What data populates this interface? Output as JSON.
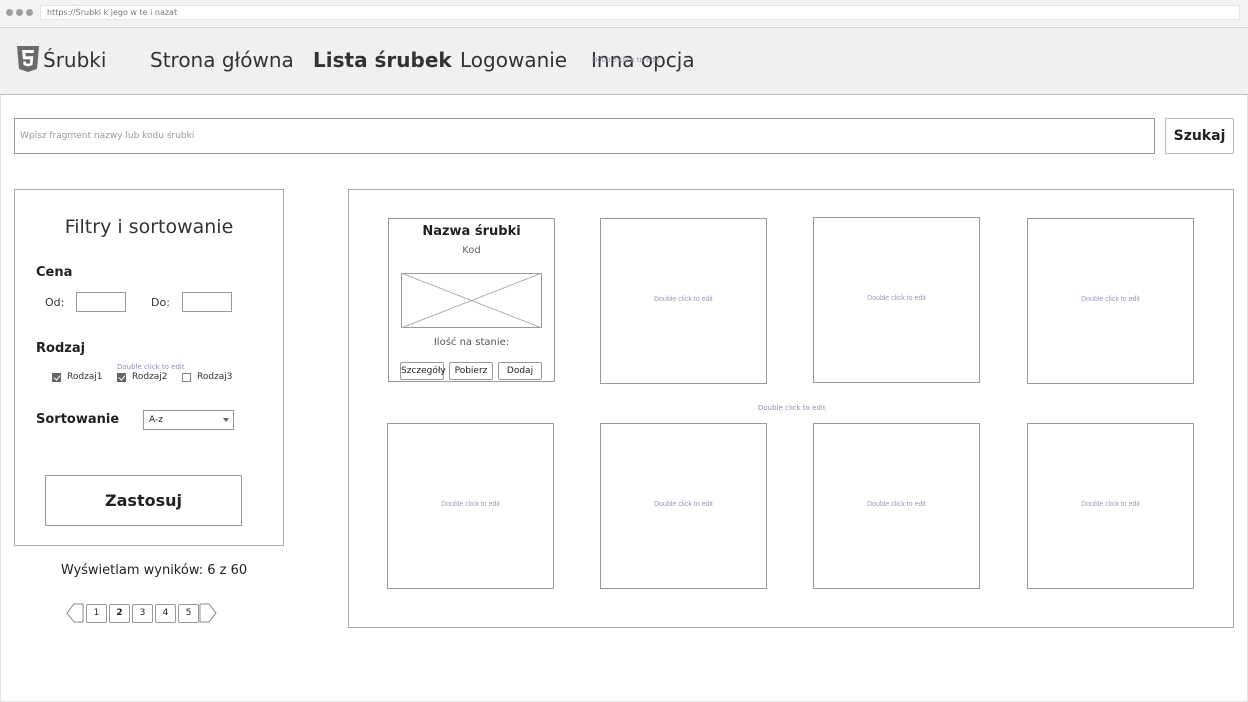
{
  "browser": {
    "url": "https://Śrubki k jego w te i nazat"
  },
  "nav": {
    "brand": "Śrubki",
    "logo_icon": "html5-shield-icon",
    "links": [
      {
        "label": "Strona główna",
        "active": false
      },
      {
        "label": "Lista śrubek",
        "active": true
      },
      {
        "label": "Logowanie",
        "active": false
      },
      {
        "label": "Inna opcja",
        "active": false
      }
    ],
    "hint": "Double click to edit"
  },
  "search": {
    "placeholder": "Wpisz fragment nazwy lub kodu śrubki",
    "button": "Szukaj"
  },
  "filters": {
    "title": "Filtry i sortowanie",
    "price_label": "Cena",
    "from_label": "Od:",
    "to_label": "Do:",
    "type_label": "Rodzaj",
    "type_hint": "Double click to edit",
    "types": [
      {
        "label": "Rodzaj1",
        "checked": true
      },
      {
        "label": "Rodzaj2",
        "checked": true
      },
      {
        "label": "Rodzaj3",
        "checked": false
      }
    ],
    "sort_label": "Sortowanie",
    "sort_value": "A-z",
    "apply_button": "Zastosuj"
  },
  "results": {
    "text": "Wyświetlam wyników: 6 z 60"
  },
  "pagination": {
    "pages": [
      "1",
      "2",
      "3",
      "4",
      "5"
    ],
    "current": "2"
  },
  "grid": {
    "hint": "Double click to edit",
    "product": {
      "name": "Nazwa śrubki",
      "code": "Kod",
      "stock_label": "Ilość na stanie:",
      "buttons": [
        "Szczegóły",
        "Pobierz",
        "Dodaj"
      ]
    },
    "placeholder_hint": "Double click to edit"
  }
}
